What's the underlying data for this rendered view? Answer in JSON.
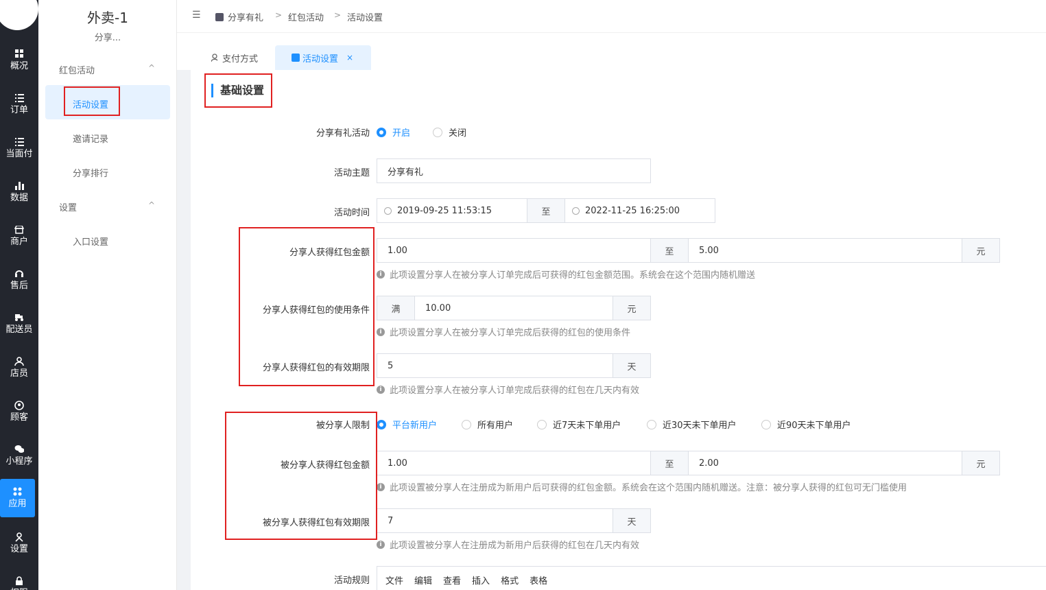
{
  "rail": {
    "items": [
      {
        "label": "概况",
        "icon": "dashboard-icon"
      },
      {
        "label": "订单",
        "icon": "list-icon"
      },
      {
        "label": "当面付",
        "icon": "list-icon"
      },
      {
        "label": "数据",
        "icon": "bar-chart-icon"
      },
      {
        "label": "商户",
        "icon": "store-icon"
      },
      {
        "label": "售后",
        "icon": "headset-icon"
      },
      {
        "label": "配送员",
        "icon": "delivery-icon"
      },
      {
        "label": "店员",
        "icon": "user-icon"
      },
      {
        "label": "顾客",
        "icon": "customer-icon"
      },
      {
        "label": "小程序",
        "icon": "wechat-icon"
      },
      {
        "label": "应用",
        "icon": "apps-icon"
      },
      {
        "label": "设置",
        "icon": "settings-icon"
      },
      {
        "label": "权限",
        "icon": "lock-icon"
      }
    ],
    "active": "应用",
    "accent": "#1e90ff"
  },
  "sidebar": {
    "title": "外卖-1",
    "subtitle": "分享...",
    "groups": [
      {
        "label": "红包活动",
        "items": [
          "活动设置",
          "邀请记录",
          "分享排行"
        ]
      },
      {
        "label": "设置",
        "items": [
          "入口设置"
        ]
      }
    ],
    "active_item": "活动设置"
  },
  "breadcrumb": [
    "分享有礼",
    "红包活动",
    "活动设置"
  ],
  "tabs": [
    {
      "label": "支付方式",
      "icon": "user-pay-icon"
    },
    {
      "label": "活动设置",
      "icon": "share-icon"
    }
  ],
  "form": {
    "section_title": "基础设置",
    "share_activity": {
      "label": "分享有礼活动",
      "options": [
        "开启",
        "关闭"
      ],
      "selected": "开启"
    },
    "theme": {
      "label": "活动主题",
      "value": "分享有礼"
    },
    "time": {
      "label": "活动时间",
      "start": "2019-09-25 11:53:15",
      "sep": "至",
      "end": "2022-11-25 16:25:00"
    },
    "sharer_amount": {
      "label": "分享人获得红包金额",
      "min": "1.00",
      "sep": "至",
      "max": "5.00",
      "unit": "元",
      "hint": "此项设置分享人在被分享人订单完成后可获得的红包金额范围。系统会在这个范围内随机赠送"
    },
    "sharer_condition": {
      "label": "分享人获得红包的使用条件",
      "prefix": "满",
      "value": "10.00",
      "unit": "元",
      "hint": "此项设置分享人在被分享人订单完成后获得的红包的使用条件"
    },
    "sharer_validity": {
      "label": "分享人获得红包的有效期限",
      "value": "5",
      "unit": "天",
      "hint": "此项设置分享人在被分享人订单完成后获得的红包在几天内有效"
    },
    "sharee_limit": {
      "label": "被分享人限制",
      "options": [
        "平台新用户",
        "所有用户",
        "近7天未下单用户",
        "近30天未下单用户",
        "近90天未下单用户"
      ],
      "selected": "平台新用户"
    },
    "sharee_amount": {
      "label": "被分享人获得红包金额",
      "min": "1.00",
      "sep": "至",
      "max": "2.00",
      "unit": "元",
      "hint": "此项设置被分享人在注册成为新用户后可获得的红包金额。系统会在这个范围内随机赠送。注意：被分享人获得的红包可无门槛使用"
    },
    "sharee_validity": {
      "label": "被分享人获得红包有效期限",
      "value": "7",
      "unit": "天",
      "hint": "此项设置被分享人在注册成为新用户后获得的红包在几天内有效"
    },
    "rules": {
      "label": "活动规则",
      "menu": [
        "文件",
        "编辑",
        "查看",
        "插入",
        "格式",
        "表格"
      ]
    }
  }
}
